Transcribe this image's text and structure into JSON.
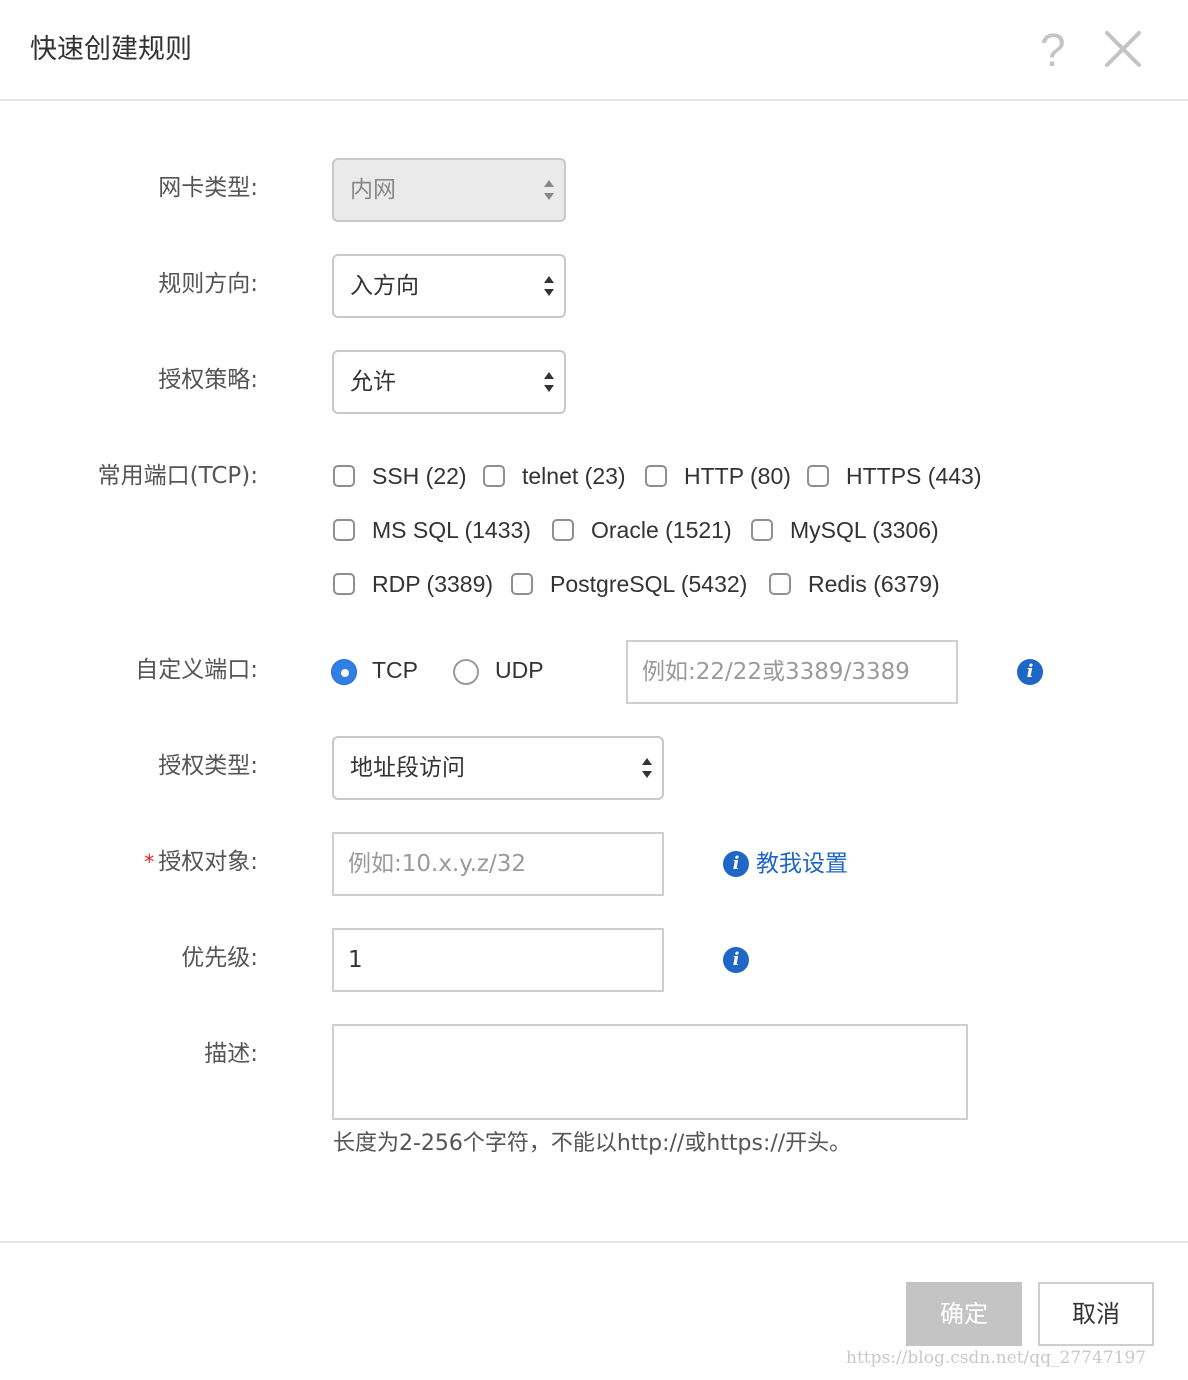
{
  "dialog": {
    "title": "快速创建规则",
    "help_icon": "question-icon",
    "close_icon": "close-icon"
  },
  "form": {
    "nic_type": {
      "label": "网卡类型:",
      "value": "内网",
      "disabled": true
    },
    "direction": {
      "label": "规则方向:",
      "value": "入方向"
    },
    "policy": {
      "label": "授权策略:",
      "value": "允许"
    },
    "common_ports": {
      "label": "常用端口(TCP):",
      "options": [
        "SSH (22)",
        "telnet (23)",
        "HTTP (80)",
        "HTTPS (443)",
        "MS SQL (1433)",
        "Oracle (1521)",
        "MySQL (3306)",
        "RDP (3389)",
        "PostgreSQL (5432)",
        "Redis (6379)"
      ]
    },
    "custom_port": {
      "label": "自定义端口:",
      "protocols": [
        "TCP",
        "UDP"
      ],
      "selected_protocol": "TCP",
      "placeholder": "例如:22/22或3389/3389"
    },
    "auth_type": {
      "label": "授权类型:",
      "value": "地址段访问"
    },
    "auth_object": {
      "required_mark": "*",
      "label": "授权对象:",
      "placeholder": "例如:10.x.y.z/32",
      "help_link": "教我设置"
    },
    "priority": {
      "label": "优先级:",
      "value": "1"
    },
    "description": {
      "label": "描述:",
      "value": "",
      "hint": "长度为2-256个字符，不能以http://或https://开头。"
    }
  },
  "footer": {
    "confirm_label": "确定",
    "cancel_label": "取消"
  },
  "watermark": "https://blog.csdn.net/qq_27747197",
  "colors": {
    "accent": "#1f66c7",
    "radio_on": "#2f7fe6",
    "required": "#e02020",
    "disabled_button": "#c4c4c4"
  }
}
